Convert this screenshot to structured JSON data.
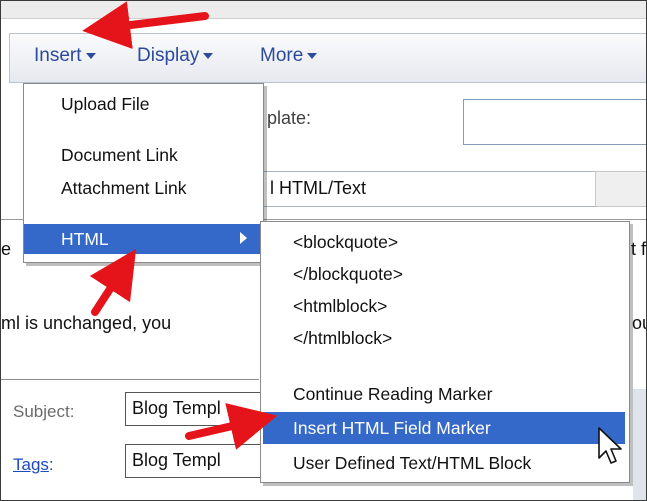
{
  "toolbar": {
    "menus": [
      {
        "label": "Insert"
      },
      {
        "label": "Display"
      },
      {
        "label": "More"
      }
    ]
  },
  "background": {
    "template_label": "plate:",
    "html_text_label": "l HTML/Text",
    "line1_left": "e",
    "line1_right": "t f",
    "line2_left": "ml is unchanged, you",
    "line2_right": "ou",
    "subject_label": "Subject:",
    "subject_value": "Blog Templ",
    "tags_label": "Tags",
    "tags_colon": ":",
    "tags_value": "Blog Templ"
  },
  "insert_menu": {
    "items": [
      {
        "label": "Upload File"
      },
      {
        "label": "Document Link"
      },
      {
        "label": "Attachment Link"
      },
      {
        "label": "HTML"
      }
    ]
  },
  "html_submenu": {
    "items": [
      {
        "label": "<blockquote>"
      },
      {
        "label": "</blockquote>"
      },
      {
        "label": "<htmlblock>"
      },
      {
        "label": "</htmlblock>"
      },
      {
        "label": "Continue Reading Marker"
      },
      {
        "label": "Insert HTML Field Marker"
      },
      {
        "label": "User Defined Text/HTML Block"
      }
    ]
  },
  "colors": {
    "menu_highlight": "#3569c9",
    "toolbar_link": "#2b4a9b",
    "annotation_arrow": "#e5141a"
  },
  "icons": [
    "caret-down-icon",
    "submenu-arrow-icon",
    "mouse-pointer-icon",
    "annotation-arrow"
  ]
}
